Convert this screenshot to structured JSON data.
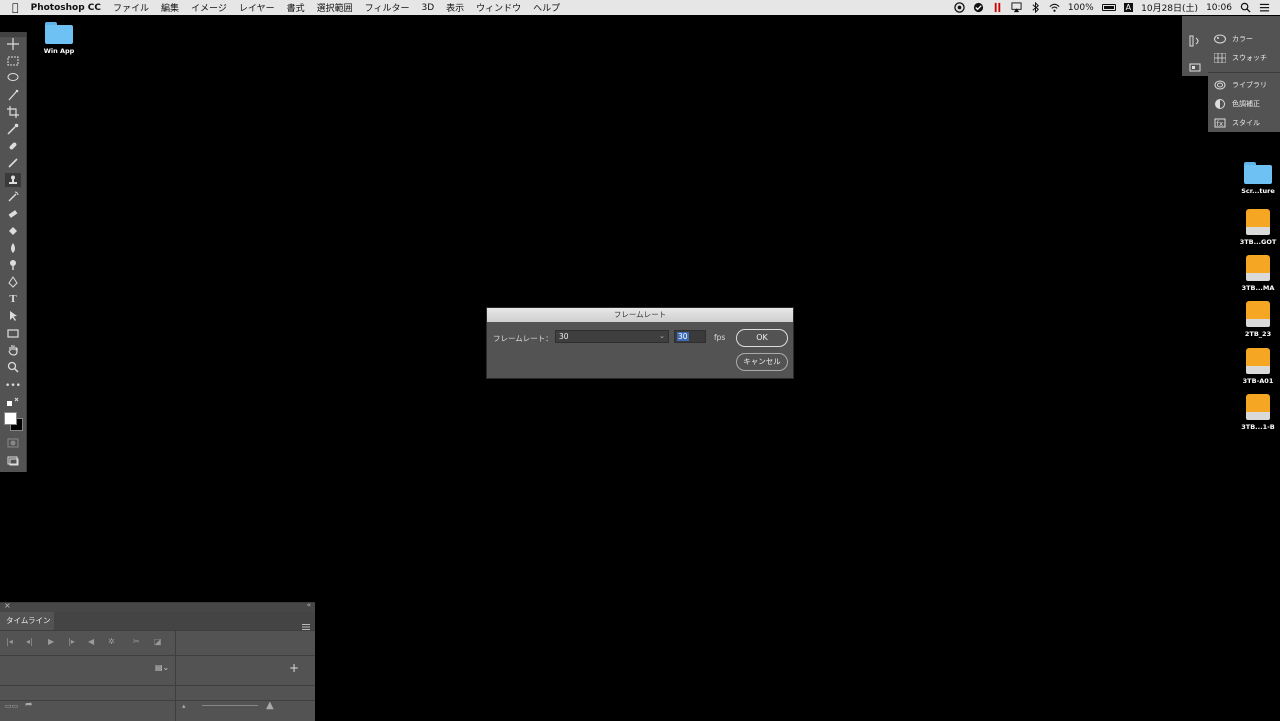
{
  "menubar": {
    "apple": "",
    "app_name": "Photoshop CC",
    "items": [
      "ファイル",
      "編集",
      "イメージ",
      "レイヤー",
      "書式",
      "選択範囲",
      "フィルター",
      "3D",
      "表示",
      "ウィンドウ",
      "ヘルプ"
    ],
    "battery": "100%",
    "input_mode": "A",
    "date": "10月28日(土)",
    "time": "10:06"
  },
  "desktop": {
    "left_icon": "Win App",
    "right_icons": [
      "Scr...ture",
      "3TB...GOT",
      "3TB...MA",
      "2TB_23",
      "3TB-A01",
      "3TB...1-B"
    ]
  },
  "right_panel": {
    "items": [
      "カラー",
      "スウォッチ",
      "ライブラリ",
      "色調補正",
      "スタイル"
    ]
  },
  "dialog": {
    "title": "フレームレート",
    "label": "フレームレート：",
    "select_value": "30",
    "fps_value": "30",
    "fps_unit": "fps",
    "ok_label": "OK",
    "cancel_label": "キャンセル"
  },
  "timeline": {
    "tab_label": "タイムライン",
    "add_label": "+"
  },
  "colors": {
    "menubar_bg": "#e6e6e6",
    "panel_bg": "#535353",
    "folder_blue": "#6ec1f3",
    "drive_orange": "#f5a623",
    "selection_blue": "#3b6bb5"
  }
}
